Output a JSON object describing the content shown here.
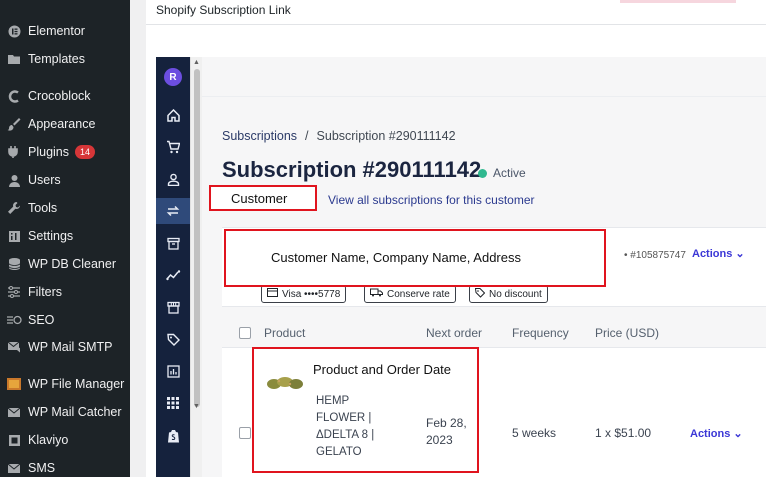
{
  "wp_menu": [
    {
      "label": "Elementor",
      "icon": "elementor-icon"
    },
    {
      "label": "Templates",
      "icon": "folder-icon"
    },
    {
      "label": "Crocoblock",
      "icon": "crocoblock-icon"
    },
    {
      "label": "Appearance",
      "icon": "brush-icon"
    },
    {
      "label": "Plugins",
      "icon": "plug-icon",
      "badge": "14"
    },
    {
      "label": "Users",
      "icon": "user-icon"
    },
    {
      "label": "Tools",
      "icon": "wrench-icon"
    },
    {
      "label": "Settings",
      "icon": "settings-icon"
    },
    {
      "label": "WP DB Cleaner",
      "icon": "database-icon"
    },
    {
      "label": "Filters",
      "icon": "sliders-icon"
    },
    {
      "label": "SEO",
      "icon": "seo-icon"
    },
    {
      "label": "WP Mail SMTP",
      "icon": "mail-icon"
    },
    {
      "label": "WP File Manager",
      "icon": "file-manager-icon"
    },
    {
      "label": "WP Mail Catcher",
      "icon": "envelope-icon"
    },
    {
      "label": "Klaviyo",
      "icon": "klaviyo-icon"
    },
    {
      "label": "SMS",
      "icon": "sms-icon"
    }
  ],
  "card": {
    "title": "Shopify Subscription Link"
  },
  "app": {
    "logo_letter": "R",
    "rail_icons": [
      "home-icon",
      "cart-icon",
      "customer-icon",
      "subscriptions-icon",
      "archive-icon",
      "analytics-icon",
      "store-icon",
      "tag-icon",
      "reports-icon",
      "apps-grid-icon",
      "shopify-icon"
    ],
    "breadcrumb": {
      "parent": "Subscriptions",
      "separator": "/",
      "current": "Subscription #290111142"
    },
    "title": "Subscription #290111142",
    "status": "Active",
    "view_all": "View all subscriptions for this customer",
    "customer_id": "• #105875747",
    "actions_label": "Actions",
    "chips": [
      {
        "label": "Visa ••••5778",
        "icon": "credit-card-icon"
      },
      {
        "label": "Conserve rate",
        "icon": "truck-icon"
      },
      {
        "label": "No discount",
        "icon": "tag-icon"
      }
    ],
    "table": {
      "headers": [
        "Product",
        "Next order",
        "Frequency",
        "Price (USD)"
      ],
      "row": {
        "product_name": "HEMP FLOWER | ΔDELTA 8 | GELATO",
        "next_order": "Feb 28, 2023",
        "frequency": "5 weeks",
        "price": "1 x $51.00",
        "actions": "Actions"
      }
    }
  },
  "annotations": {
    "customer": "Customer",
    "customer_details": "Customer Name, Company Name, Address",
    "product": "Product and Order Date",
    "color": "#e0141e"
  }
}
